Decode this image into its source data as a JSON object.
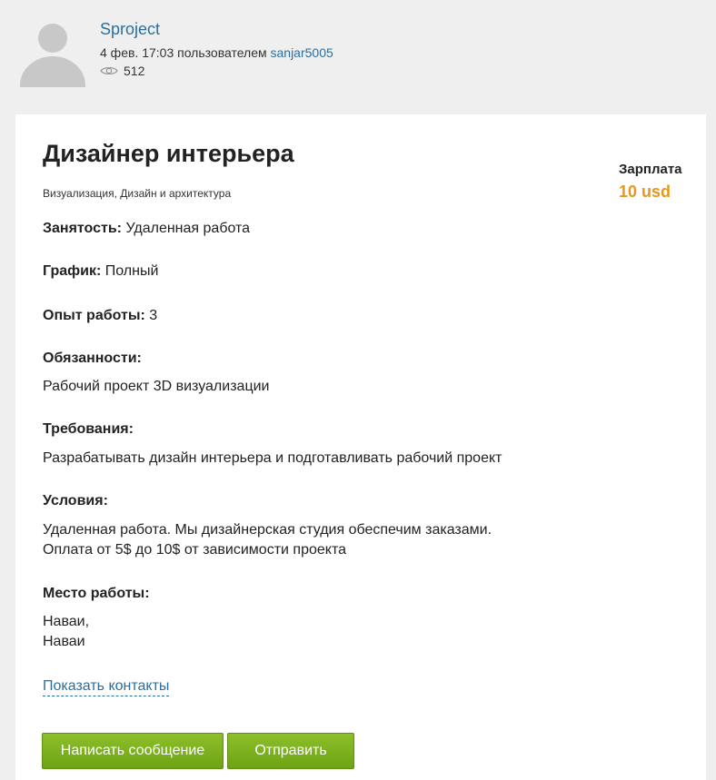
{
  "author": {
    "name": "Sproject",
    "posted_prefix": "4 фев. 17:03 пользователем ",
    "username": "sanjar5005",
    "views": "512"
  },
  "job": {
    "title": "Дизайнер интерьера",
    "category": "Визуализация, Дизайн и архитектура",
    "salary_label": "Зарплата",
    "salary_value": "10 usd",
    "employment_label": "Занятость:",
    "employment_value": " Удаленная работа",
    "schedule_label": "График:",
    "schedule_value": " Полный",
    "experience_label": "Опыт работы:",
    "experience_value": " 3",
    "duties_label": "Обязанности:",
    "duties_text": "Рабочий проект 3D визуализации",
    "requirements_label": "Требования:",
    "requirements_text": "Разрабатывать дизайн интерьера и подготавливать рабочий проект",
    "conditions_label": "Условия:",
    "conditions_line1": "Удаленная работа. Мы дизайнерская студия обеспечим заказами.",
    "conditions_line2": "Оплата от 5$ до 10$ от зависимости проекта",
    "location_label": "Место работы:",
    "location_line1": "Наваи,",
    "location_line2": "Наваи"
  },
  "actions": {
    "show_contacts": "Показать контакты",
    "write_message": "Написать сообщение",
    "send": "Отправить"
  },
  "colors": {
    "link": "#2a6fa0",
    "salary": "#e8971e",
    "button": "#7ab01e"
  },
  "icons": {
    "views": "eye-icon",
    "avatar": "default-user-avatar"
  }
}
